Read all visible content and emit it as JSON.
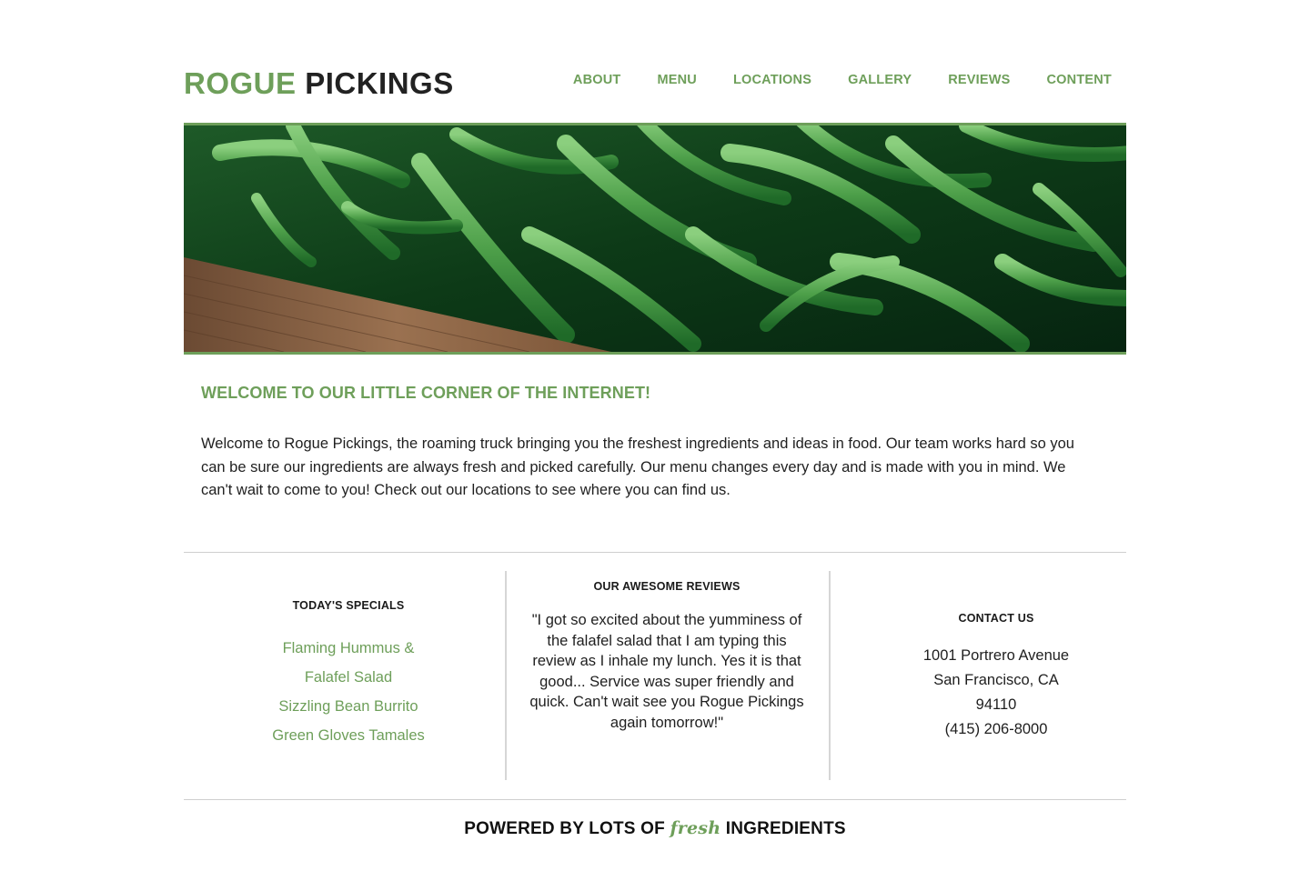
{
  "site": {
    "logo_part1": "ROGUE",
    "logo_part2": "PICKINGS"
  },
  "nav": {
    "items": [
      {
        "label": "ABOUT"
      },
      {
        "label": "MENU"
      },
      {
        "label": "LOCATIONS"
      },
      {
        "label": "GALLERY"
      },
      {
        "label": "REVIEWS"
      },
      {
        "label": "CONTENT"
      }
    ]
  },
  "welcome": {
    "title": "WELCOME TO OUR LITTLE CORNER OF THE INTERNET!",
    "text": "Welcome to Rogue Pickings, the roaming truck bringing you the freshest ingredients and ideas in food. Our team works hard so you can be sure our ingredients are always fresh and picked carefully. Our menu changes every day and is made with you in mind. We can't wait to come to you! Check out our locations to see where you can find us."
  },
  "specials": {
    "title": "TODAY'S SPECIALS",
    "items": [
      {
        "label": "Flaming Hummus &"
      },
      {
        "label": "Falafel Salad"
      },
      {
        "label": "Sizzling Bean Burrito"
      },
      {
        "label": "Green Gloves Tamales"
      }
    ]
  },
  "reviews": {
    "title": "OUR AWESOME REVIEWS",
    "quote": "\"I got so excited about the yumminess of the falafel salad that I am typing this review as I inhale my lunch. Yes it is that good... Service was super friendly and quick. Can't wait see you Rogue Pickings again tomorrow!\""
  },
  "contact": {
    "title": "CONTACT US",
    "address_line1": "1001 Portrero Avenue",
    "address_line2": "San Francisco, CA",
    "zip": "94110",
    "phone": "(415) 206-8000"
  },
  "footer": {
    "before": "POWERED BY LOTS OF",
    "fresh": "fresh",
    "after": "INGREDIENTS"
  },
  "colors": {
    "accent": "#6e9f5a",
    "text": "#1f1f1f",
    "divider": "#cfcfcf"
  }
}
